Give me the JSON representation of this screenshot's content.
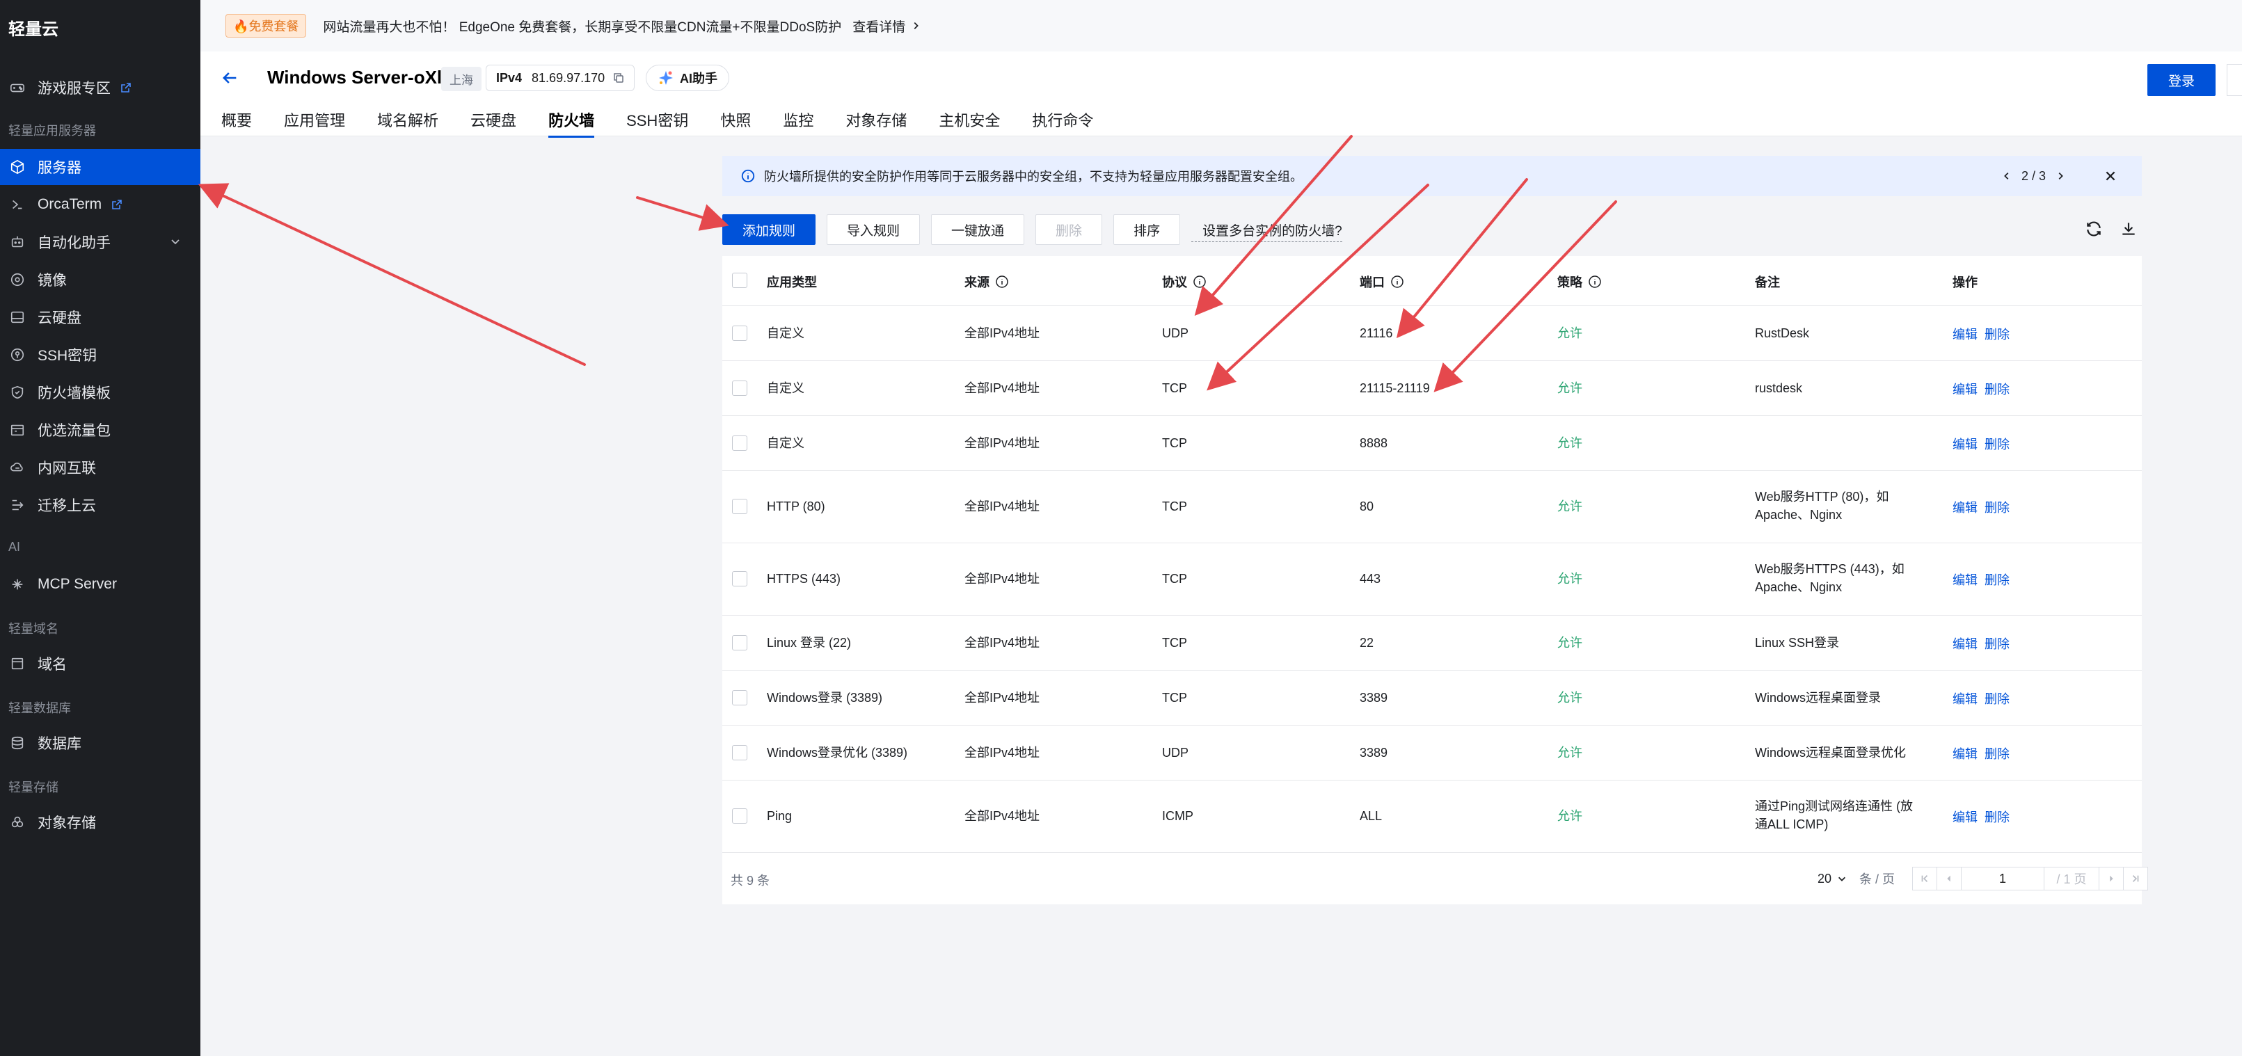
{
  "sidebar": {
    "brand": "轻量云",
    "sections": {
      "light_app_server": "轻量应用服务器",
      "ai": "AI",
      "light_domain": "轻量域名",
      "light_db": "轻量数据库",
      "light_storage": "轻量存储"
    },
    "items": {
      "game": "游戏服专区",
      "server": "服务器",
      "orcaterm": "OrcaTerm",
      "automation": "自动化助手",
      "image": "镜像",
      "cloud_disk": "云硬盘",
      "ssh_key": "SSH密钥",
      "fw_template": "防火墙模板",
      "traffic_pkg": "优选流量包",
      "intranet": "内网互联",
      "migrate": "迁移上云",
      "mcp": "MCP Server",
      "domain": "域名",
      "database": "数据库",
      "object_storage": "对象存储"
    }
  },
  "notice": {
    "badge": "🔥免费套餐",
    "text": "网站流量再大也不怕！ EdgeOne 免费套餐，长期享受不限量CDN流量+不限量DDoS防护",
    "detail": "查看详情"
  },
  "header": {
    "server_name": "Windows Server-oXli",
    "region": "上海",
    "ip_label": "IPv4",
    "ip_value": "81.69.97.170",
    "ai_button": "AI助手",
    "login": "登录",
    "tabs": [
      "概要",
      "应用管理",
      "域名解析",
      "云硬盘",
      "防火墙",
      "SSH密钥",
      "快照",
      "监控",
      "对象存储",
      "主机安全",
      "执行命令"
    ],
    "active_tab_index": 4
  },
  "banner": {
    "text": "防火墙所提供的安全防护作用等同于云服务器中的安全组，不支持为轻量应用服务器配置安全组。",
    "pager": "2 / 3"
  },
  "toolbar": {
    "add_rule": "添加规则",
    "import_rule": "导入规则",
    "allow_all": "一键放通",
    "delete": "删除",
    "sort": "排序",
    "multi_fw": "设置多台实例的防火墙?"
  },
  "table": {
    "headers": {
      "app_type": "应用类型",
      "source": "来源",
      "protocol": "协议",
      "port": "端口",
      "policy": "策略",
      "note": "备注",
      "ops": "操作"
    },
    "op_edit": "编辑",
    "op_delete": "删除",
    "rows": [
      {
        "app_type": "自定义",
        "source": "全部IPv4地址",
        "protocol": "UDP",
        "port": "21116",
        "policy": "允许",
        "note": "RustDesk"
      },
      {
        "app_type": "自定义",
        "source": "全部IPv4地址",
        "protocol": "TCP",
        "port": "21115-21119",
        "policy": "允许",
        "note": "rustdesk"
      },
      {
        "app_type": "自定义",
        "source": "全部IPv4地址",
        "protocol": "TCP",
        "port": "8888",
        "policy": "允许",
        "note": ""
      },
      {
        "app_type": "HTTP (80)",
        "source": "全部IPv4地址",
        "protocol": "TCP",
        "port": "80",
        "policy": "允许",
        "note": "Web服务HTTP (80)，如Apache、Nginx"
      },
      {
        "app_type": "HTTPS (443)",
        "source": "全部IPv4地址",
        "protocol": "TCP",
        "port": "443",
        "policy": "允许",
        "note": "Web服务HTTPS (443)，如Apache、Nginx"
      },
      {
        "app_type": "Linux 登录 (22)",
        "source": "全部IPv4地址",
        "protocol": "TCP",
        "port": "22",
        "policy": "允许",
        "note": "Linux SSH登录"
      },
      {
        "app_type": "Windows登录 (3389)",
        "source": "全部IPv4地址",
        "protocol": "TCP",
        "port": "3389",
        "policy": "允许",
        "note": "Windows远程桌面登录"
      },
      {
        "app_type": "Windows登录优化 (3389)",
        "source": "全部IPv4地址",
        "protocol": "UDP",
        "port": "3389",
        "policy": "允许",
        "note": "Windows远程桌面登录优化"
      },
      {
        "app_type": "Ping",
        "source": "全部IPv4地址",
        "protocol": "ICMP",
        "port": "ALL",
        "policy": "允许",
        "note": "通过Ping测试网络连通性 (放通ALL ICMP)"
      }
    ],
    "footer": {
      "total": "共 9 条",
      "page_size": "20",
      "page_size_unit": "条 / 页",
      "page_input": "1",
      "page_total": "/ 1 页"
    }
  },
  "colors": {
    "primary": "#0052d9",
    "sidebar_bg": "#1d1f23",
    "allow_green": "#2ba471",
    "annotation_red": "#e5484d"
  }
}
